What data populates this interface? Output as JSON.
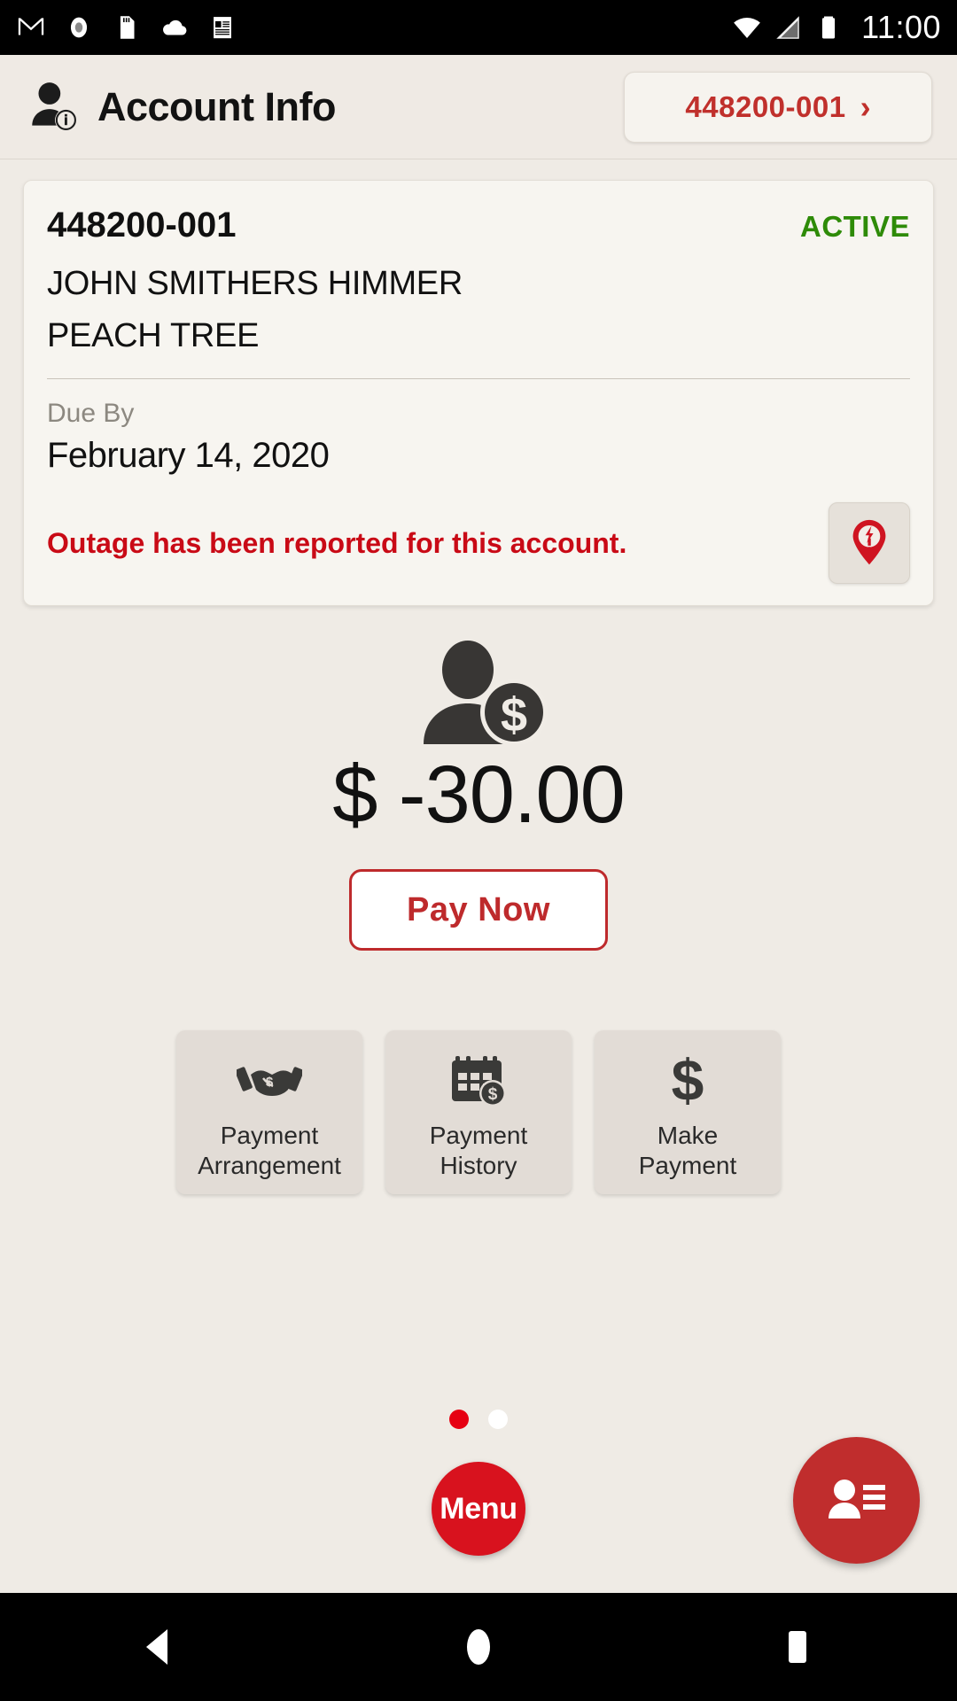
{
  "status_bar": {
    "icons": [
      "gmail-icon",
      "record-icon",
      "sd-card-icon",
      "cloud-icon",
      "notes-icon"
    ],
    "wifi_icon": "wifi-icon",
    "signal_icon": "signal-icon",
    "battery_icon": "battery-icon",
    "clock": "11:00"
  },
  "header": {
    "icon": "account-info-icon",
    "title": "Account Info",
    "account_chip": {
      "label": "448200-001",
      "chevron": "›"
    }
  },
  "account_card": {
    "account_number": "448200-001",
    "status": "ACTIVE",
    "status_color": "#2E8B08",
    "name": "JOHN SMITHERS HIMMER",
    "address": "PEACH TREE",
    "due_label": "Due By",
    "due_date": "February 14, 2020",
    "outage_message": "Outage has been reported for this account.",
    "outage_color": "#C90A16",
    "outage_icon": "outage-pin-icon"
  },
  "balance": {
    "icon": "person-dollar-icon",
    "currency": "$",
    "amount": "-30.00",
    "display": "$ -30.00",
    "pay_now_label": "Pay Now",
    "accent_color": "#BE2A2C"
  },
  "tiles": [
    {
      "icon": "handshake-icon",
      "line1": "Payment",
      "line2": "Arrangement"
    },
    {
      "icon": "calendar-dollar-icon",
      "line1": "Payment",
      "line2": "History"
    },
    {
      "icon": "dollar-sign-icon",
      "line1": "Make",
      "line2": "Payment"
    }
  ],
  "pager": {
    "total": 2,
    "active_index": 0,
    "active_color": "#E60012",
    "inactive_color": "#FFFFFF"
  },
  "menu_fab": {
    "label": "Menu",
    "color": "#D8121E"
  },
  "contact_fab": {
    "icon": "contact-card-icon",
    "color": "#C02D2D"
  },
  "nav_bar": {
    "back": "back-nav-icon",
    "home": "home-nav-icon",
    "recents": "recents-nav-icon"
  }
}
